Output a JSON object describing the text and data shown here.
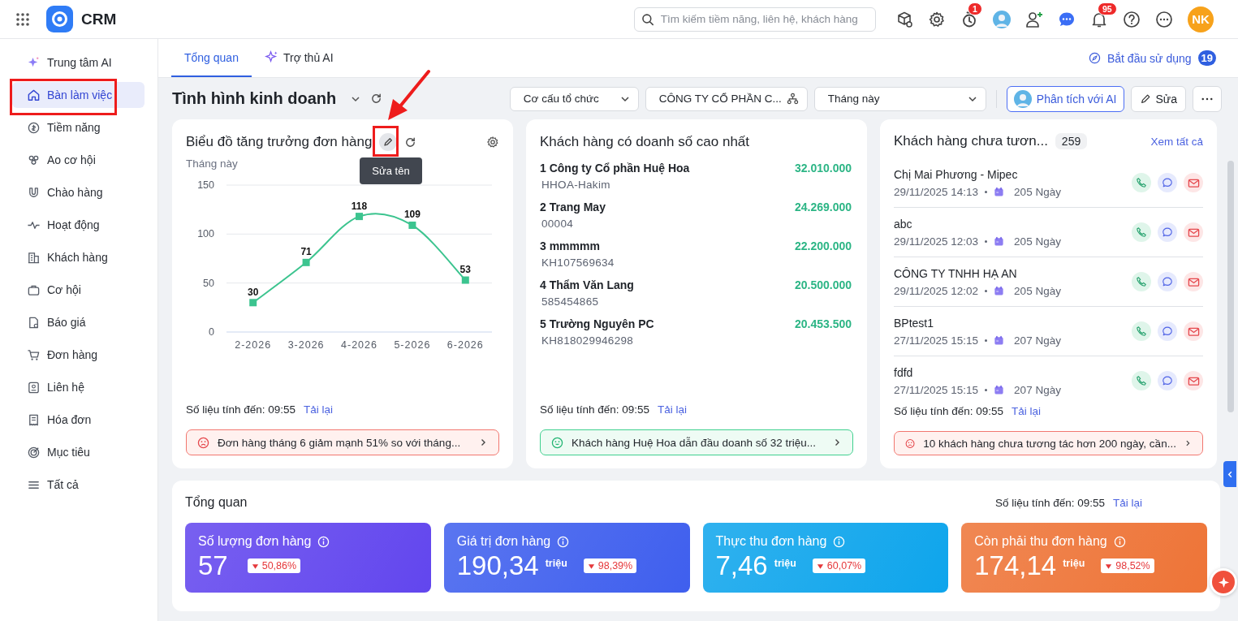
{
  "app": {
    "name": "CRM"
  },
  "search": {
    "placeholder": "Tìm kiếm tiềm năng, liên hệ, khách hàng"
  },
  "header_icons": [
    {
      "kind": "cube-search"
    },
    {
      "kind": "gear"
    },
    {
      "kind": "timer",
      "badge": "1"
    },
    {
      "kind": "avatar"
    },
    {
      "kind": "add-user"
    },
    {
      "kind": "chat"
    },
    {
      "kind": "bell",
      "badge": "95"
    },
    {
      "kind": "help"
    },
    {
      "kind": "more"
    }
  ],
  "user": {
    "initials": "NK"
  },
  "sidebar": {
    "items": [
      {
        "label": "Trung tâm AI",
        "selected": false
      },
      {
        "label": "Bàn làm việc",
        "selected": true
      },
      {
        "label": "Tiềm năng",
        "selected": false
      },
      {
        "label": "Ao cơ hội",
        "selected": false
      },
      {
        "label": "Chào hàng",
        "selected": false
      },
      {
        "label": "Hoạt động",
        "selected": false
      },
      {
        "label": "Khách hàng",
        "selected": false
      },
      {
        "label": "Cơ hội",
        "selected": false
      },
      {
        "label": "Báo giá",
        "selected": false
      },
      {
        "label": "Đơn hàng",
        "selected": false
      },
      {
        "label": "Liên hệ",
        "selected": false
      },
      {
        "label": "Hóa đơn",
        "selected": false
      },
      {
        "label": "Mục tiêu",
        "selected": false
      },
      {
        "label": "Tất cả",
        "selected": false
      }
    ]
  },
  "tabs": [
    {
      "label": "Tổng quan",
      "selected": true
    },
    {
      "label": "Trợ thủ AI",
      "selected": false
    }
  ],
  "getting_started": {
    "label": "Bắt đầu sử dụng",
    "count": "19"
  },
  "dashboard": {
    "title": "Tình hình kinh doanh",
    "filters": [
      {
        "kind": "select",
        "value": "Cơ cấu tổ chức"
      },
      {
        "kind": "org",
        "value": "CÔNG TY CỔ PHẦN C..."
      },
      {
        "kind": "wide-select",
        "value": "Tháng này"
      }
    ],
    "ai_button": "Phân tích với AI",
    "edit_button": "Sửa"
  },
  "chart_card": {
    "title": "Biểu đồ tăng trưởng đơn hàng",
    "tooltip": "Sửa tên",
    "period": "Tháng này",
    "chart_data": {
      "type": "line",
      "categories": [
        "2-2026",
        "3-2026",
        "4-2026",
        "5-2026",
        "6-2026"
      ],
      "series": [
        {
          "color": "#3cc48f",
          "marker": "square",
          "values": [
            30,
            71,
            118,
            109,
            53
          ]
        }
      ],
      "ylim": [
        0,
        150
      ],
      "yticks": [
        0,
        50,
        100,
        150
      ],
      "data_labels": true
    },
    "updated": "Số liệu tính đến: 09:55",
    "reload": "Tải lại",
    "insight": {
      "negative": true,
      "text": "Đơn hàng tháng 6 giảm mạnh 51% so với tháng..."
    }
  },
  "top_customers": {
    "title": "Khách hàng có doanh số cao nhất",
    "rows": [
      {
        "name": "1 Công ty Cổ phần Huệ Hoa",
        "code": "HHOA-Hakim",
        "amount": "32.010.000"
      },
      {
        "name": "2 Trang May",
        "code": "00004",
        "amount": "24.269.000"
      },
      {
        "name": "3 mmmmm",
        "code": "KH107569634",
        "amount": "22.200.000"
      },
      {
        "name": "4 Thẩm Văn Lang",
        "code": "585454865",
        "amount": "20.500.000"
      },
      {
        "name": "5 Trường Nguyên PC",
        "code": "KH818029946298",
        "amount": "20.453.500"
      }
    ],
    "updated": "Số liệu tính đến: 09:55",
    "reload": "Tải lại",
    "insight": {
      "negative": false,
      "text": "Khách hàng Huệ Hoa dẫn đầu doanh số 32 triệu..."
    }
  },
  "inactive_customers": {
    "title": "Khách hàng chưa tươn...",
    "count": "259",
    "view_all": "Xem tất cả",
    "rows": [
      {
        "name": "Chị Mai Phương - Mipec",
        "datetime": "29/11/2025 14:13",
        "days": "205 Ngày"
      },
      {
        "name": "abc",
        "datetime": "29/11/2025 12:03",
        "days": "205 Ngày"
      },
      {
        "name": "CÔNG TY TNHH HẠ AN",
        "datetime": "29/11/2025 12:02",
        "days": "205 Ngày"
      },
      {
        "name": "BPtest1",
        "datetime": "27/11/2025 15:15",
        "days": "207 Ngày"
      },
      {
        "name": "fdfd",
        "datetime": "27/11/2025 15:15",
        "days": "207 Ngày"
      }
    ],
    "updated": "Số liệu tính đến: 09:55",
    "reload": "Tải lại",
    "insight": {
      "negative": true,
      "text": "10 khách hàng chưa tương tác hơn 200 ngày, cần..."
    }
  },
  "overview": {
    "title": "Tổng quan",
    "updated": "Số liệu tính đến: 09:55",
    "reload": "Tải lại",
    "metrics": [
      {
        "label": "Số lượng đơn hàng",
        "value": "57",
        "change": "50,86%",
        "decrease": true,
        "color": "#6246ee"
      },
      {
        "label": "Giá trị đơn hàng",
        "value": "190,34",
        "unit": "triệu",
        "change": "98,39%",
        "decrease": true,
        "color": "#3f5fee"
      },
      {
        "label": "Thực thu đơn hàng",
        "value": "7,46",
        "unit": "triệu",
        "change": "60,07%",
        "decrease": true,
        "color": "#0ea5ec"
      },
      {
        "label": "Còn phải thu đơn hàng",
        "value": "174,14",
        "unit": "triệu",
        "change": "98,52%",
        "decrease": true,
        "color": "#ee7437"
      }
    ]
  }
}
